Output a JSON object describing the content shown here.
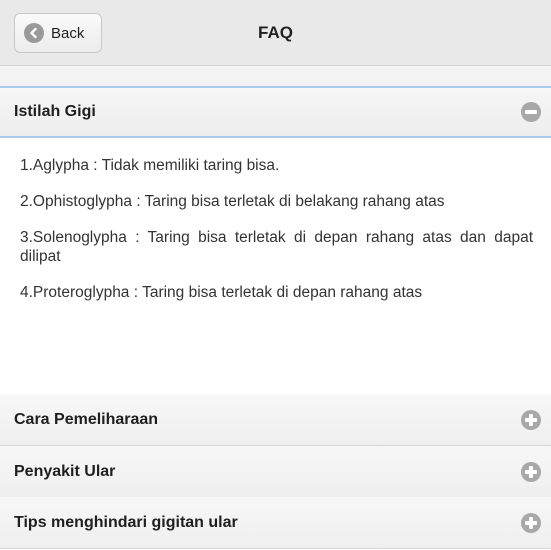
{
  "header": {
    "back_label": "Back",
    "title": "FAQ"
  },
  "sections": [
    {
      "title": "Istilah Gigi",
      "expanded": true,
      "toggle_icon": "minus-icon",
      "items": [
        "1.Aglypha : Tidak memiliki taring bisa.",
        "2.Ophistoglypha : Taring bisa terletak di belakang rahang atas",
        "3.Solenoglypha : Taring bisa terletak di depan rahang atas dan dapat dilipat",
        "4.Proteroglypha : Taring bisa terletak di depan rahang atas"
      ]
    },
    {
      "title": "Cara Pemeliharaan",
      "expanded": false,
      "toggle_icon": "plus-icon"
    },
    {
      "title": "Penyakit Ular",
      "expanded": false,
      "toggle_icon": "plus-icon"
    },
    {
      "title": "Tips menghindari gigitan ular",
      "expanded": false,
      "toggle_icon": "plus-icon"
    }
  ],
  "colors": {
    "header_bg": "#e9e9e9",
    "active_border": "#a9cbe9",
    "icon_gray": "#a8a8a8"
  }
}
